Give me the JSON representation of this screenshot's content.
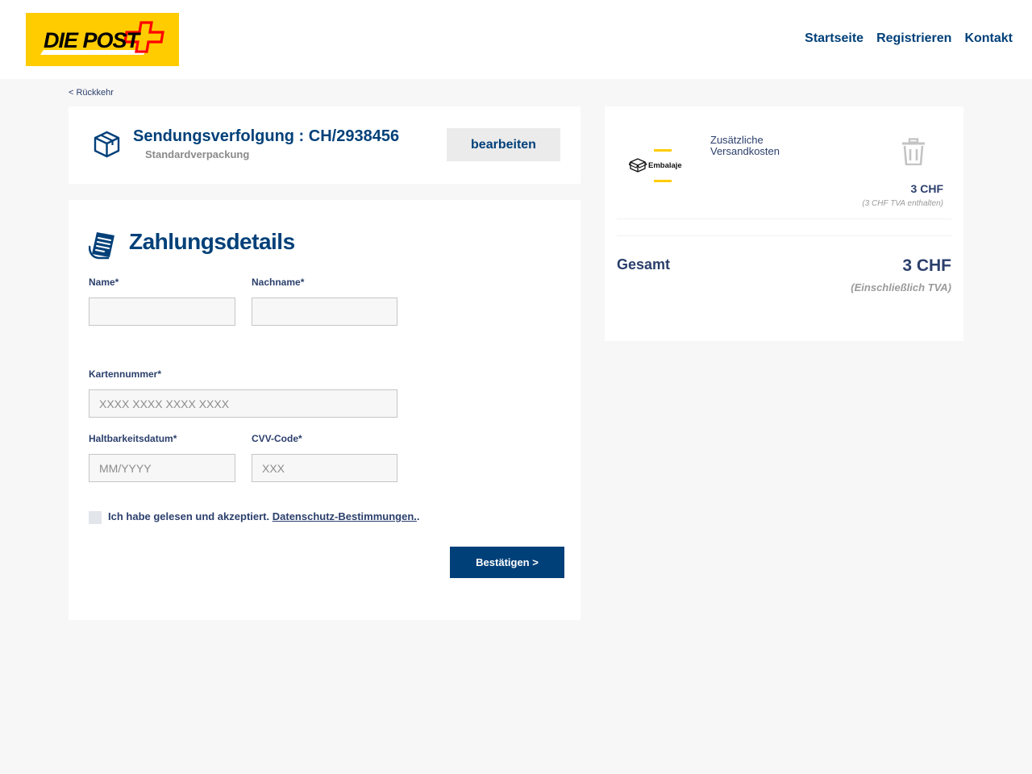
{
  "header": {
    "logo_text": "DIE POST",
    "nav": [
      "Startseite",
      "Registrieren",
      "Kontakt"
    ]
  },
  "back_link": "< Rückkehr",
  "tracking": {
    "title": "Sendungsverfolgung : CH/2938456",
    "subtitle": "Standardverpackung",
    "edit_label": "bearbeiten"
  },
  "payment": {
    "title": "Zahlungsdetails",
    "first_name_label": "Name*",
    "last_name_label": "Nachname*",
    "card_label": "Kartennummer*",
    "card_placeholder": "XXXX XXXX XXXX XXXX",
    "expiry_label": "Haltbarkeitsdatum*",
    "expiry_placeholder": "MM/YYYY",
    "cvv_label": "CVV-Code*",
    "cvv_placeholder": "XXX",
    "consent_text": "Ich habe gelesen und akzeptiert.",
    "consent_link": "Datenschutz-Bestimmungen.",
    "consent_suffix": ".",
    "confirm_label": "Bestätigen >"
  },
  "summary": {
    "item_logo_text": "Embalaje",
    "item_name_line1": "Zusätzliche",
    "item_name_line2": "Versandkosten",
    "item_price": "3 CHF",
    "item_tax": "(3 CHF TVA enthalten)",
    "total_label": "Gesamt",
    "total_value": "3 CHF",
    "total_note": "(Einschließlich TVA)"
  },
  "colors": {
    "brand_yellow": "#ffcc00",
    "brand_blue": "#004079",
    "swiss_red": "#ff0000"
  },
  "icons": [
    "box-icon",
    "receipt-icon",
    "trash-icon",
    "swiss-cross-icon"
  ]
}
